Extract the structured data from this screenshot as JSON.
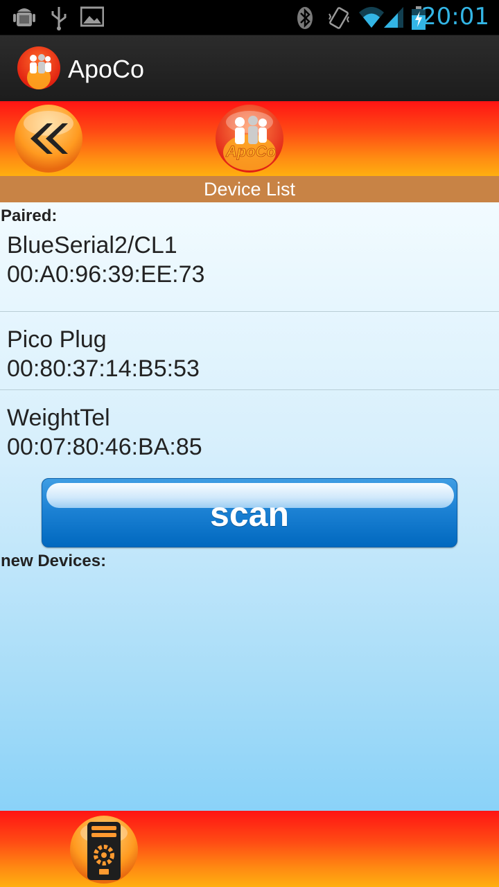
{
  "status_bar": {
    "time": "20:01",
    "left_icons": [
      "android-debug-icon",
      "usb-icon",
      "image-icon"
    ],
    "right_icons": [
      "bluetooth-icon",
      "vibrate-icon",
      "wifi-icon",
      "signal-icon",
      "battery-charging-icon"
    ]
  },
  "action_bar": {
    "title": "ApoCo"
  },
  "header": {
    "logo_text": "ApoCo"
  },
  "title_bar": {
    "label": "Device List"
  },
  "paired": {
    "label": "Paired:",
    "devices": [
      {
        "name": "BlueSerial2/CL1",
        "address": "00:A0:96:39:EE:73"
      },
      {
        "name": "Pico Plug",
        "address": "00:80:37:14:B5:53"
      },
      {
        "name": "WeightTel",
        "address": "00:07:80:46:BA:85"
      }
    ]
  },
  "scan_button": {
    "label": "scan"
  },
  "new_devices": {
    "label": "new Devices:"
  },
  "colors": {
    "accent": "#33b5e5",
    "header_red": "#ff1414",
    "header_orange": "#ffaf10",
    "title_bar": "#c88345",
    "scan_blue": "#1d82d4"
  }
}
